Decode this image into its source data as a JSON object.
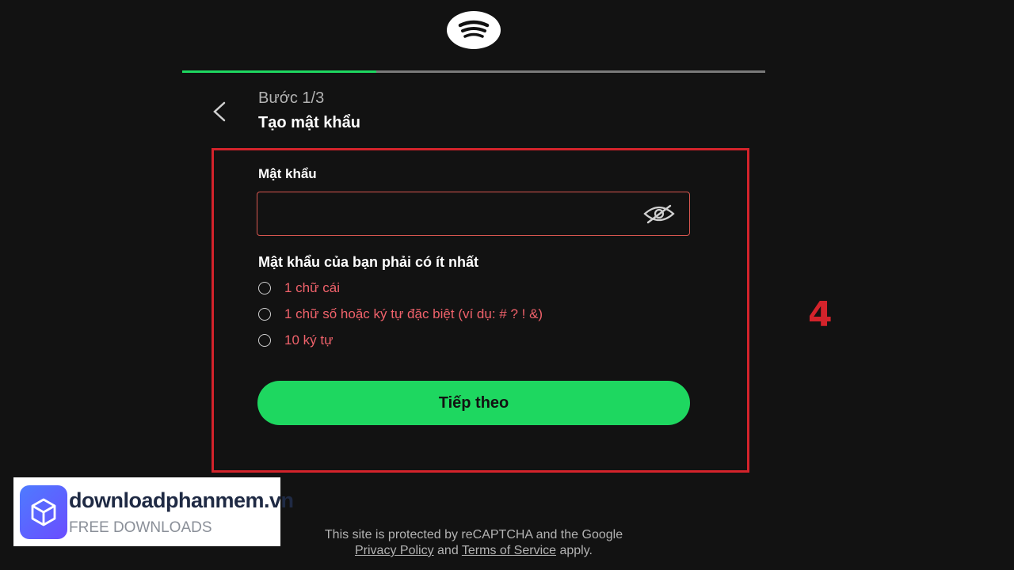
{
  "header": {
    "logo_icon": "spotify-logo-icon"
  },
  "progress": {
    "value": 0.333
  },
  "step": {
    "label": "Bước 1/3",
    "title": "Tạo mật khẩu"
  },
  "password": {
    "label": "Mật khẩu",
    "value": "",
    "toggle_icon": "eye-off-icon"
  },
  "requirements": {
    "title": "Mật khẩu của bạn phải có ít nhất",
    "items": [
      {
        "label": "1 chữ cái"
      },
      {
        "label": "1 chữ số hoặc ký tự đặc biệt (ví dụ: # ? ! &)"
      },
      {
        "label": "10 ký tự"
      }
    ]
  },
  "cta": {
    "label": "Tiếp theo"
  },
  "annotation": {
    "number": "4"
  },
  "footer": {
    "line1": "This site is protected by reCAPTCHA and the Google",
    "privacy": "Privacy Policy",
    "and": "and",
    "terms": "Terms of Service",
    "apply": "apply."
  },
  "watermark": {
    "title": "downloadphanmem.vn",
    "subtitle": "FREE DOWNLOADS"
  },
  "colors": {
    "accent": "#1ed760",
    "error": "#f0626b",
    "highlight": "#d3232b",
    "background": "#121212"
  }
}
